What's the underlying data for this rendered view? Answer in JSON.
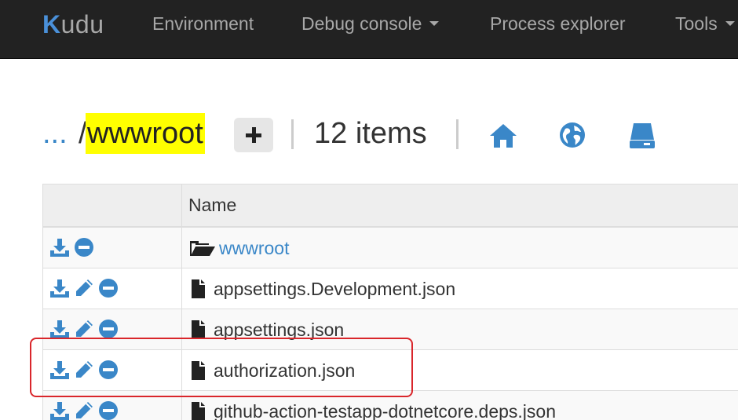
{
  "brand": {
    "logo_text": "Kudu",
    "k": "K",
    "rest": "udu"
  },
  "navbar": {
    "items": [
      {
        "label": "Environment",
        "dropdown": false
      },
      {
        "label": "Debug console",
        "dropdown": true
      },
      {
        "label": "Process explorer",
        "dropdown": false
      },
      {
        "label": "Tools",
        "dropdown": true
      }
    ]
  },
  "breadcrumb": {
    "ellipsis": "...",
    "separator": "/",
    "current": "wwwroot"
  },
  "header": {
    "items_count": "12 items",
    "icons": [
      "home-icon",
      "globe-icon",
      "drive-icon"
    ]
  },
  "table": {
    "column_name": "Name",
    "rows": [
      {
        "name": "wwwroot",
        "type": "folder",
        "actions": [
          "download",
          "delete"
        ]
      },
      {
        "name": "appsettings.Development.json",
        "type": "file",
        "actions": [
          "download",
          "edit",
          "delete"
        ]
      },
      {
        "name": "appsettings.json",
        "type": "file",
        "actions": [
          "download",
          "edit",
          "delete"
        ]
      },
      {
        "name": "authorization.json",
        "type": "file",
        "actions": [
          "download",
          "edit",
          "delete"
        ]
      },
      {
        "name": "github-action-testapp-dotnetcore.deps.json",
        "type": "file",
        "actions": [
          "download",
          "edit",
          "delete"
        ]
      }
    ]
  },
  "colors": {
    "navbar_bg": "#222222",
    "link": "#3a87c8",
    "highlight": "#ffff00",
    "annotation_border": "#d9262b"
  }
}
